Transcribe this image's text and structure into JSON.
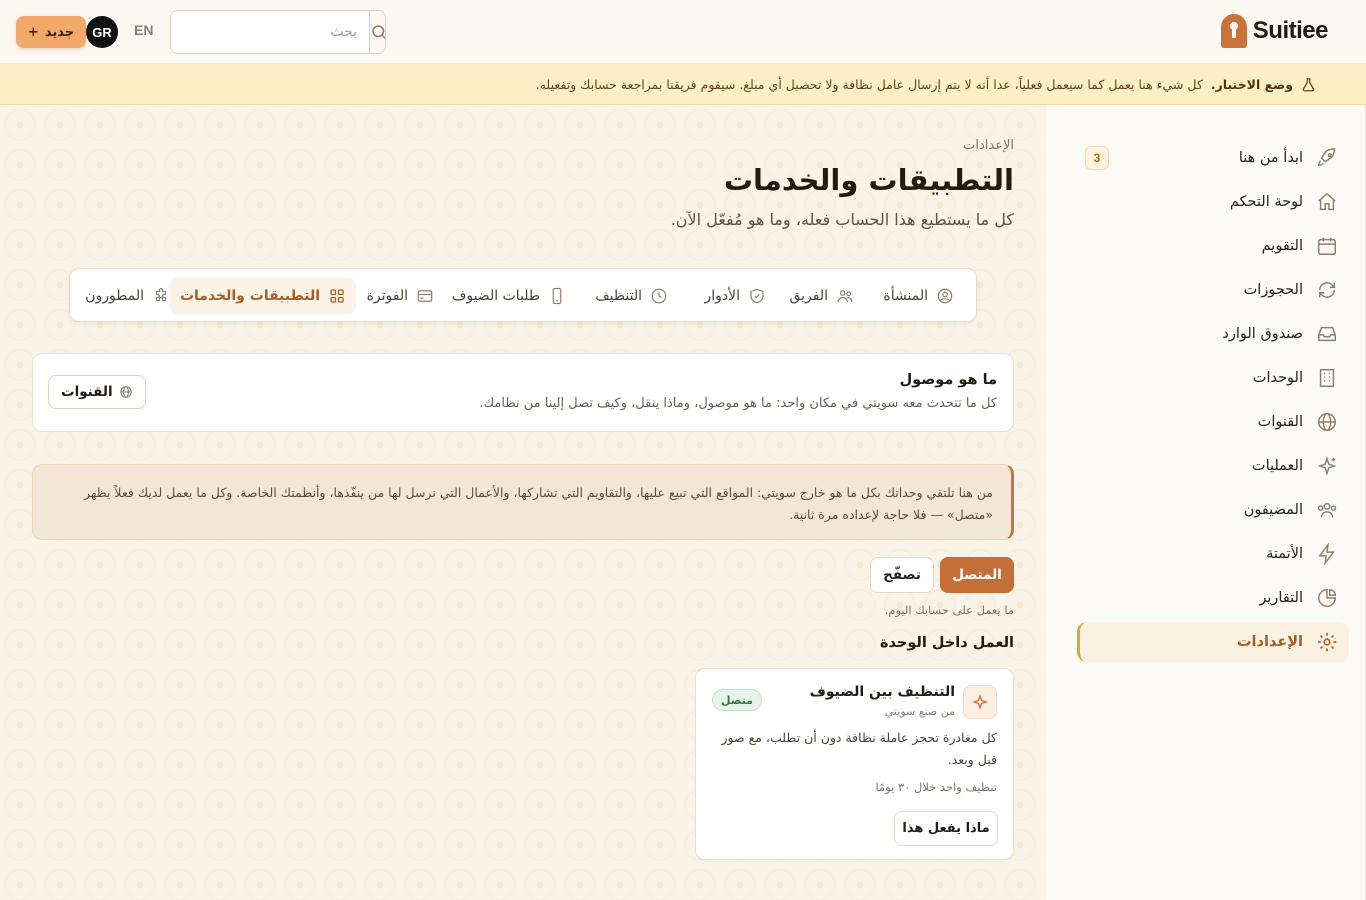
{
  "brand": {
    "name": "Suitiee"
  },
  "topbar": {
    "search_placeholder": "بحث",
    "lang": "EN",
    "avatar": "GR",
    "new_label": "جديد",
    "new_plus": "+"
  },
  "banner": {
    "label": "وضع الاختبار.",
    "text": "كل شيء هنا يعمل كما سيعمل فعلياً، عدا أنه لا يتم إرسال عامل نظافة ولا تحصيل أي مبلغ. سيقوم فريقنا بمراجعة حسابك وتفعيله."
  },
  "sidebar": {
    "items": [
      {
        "label": "ابدأ من هنا",
        "icon": "rocket-icon",
        "badge": "3"
      },
      {
        "label": "لوحة التحكم",
        "icon": "home-icon"
      },
      {
        "label": "التقويم",
        "icon": "calendar-icon"
      },
      {
        "label": "الحجوزات",
        "icon": "refresh-icon"
      },
      {
        "label": "صندوق الوارد",
        "icon": "inbox-icon"
      },
      {
        "label": "الوحدات",
        "icon": "building-icon"
      },
      {
        "label": "القنوات",
        "icon": "globe-icon"
      },
      {
        "label": "العمليات",
        "icon": "sparkles-icon"
      },
      {
        "label": "المضيفون",
        "icon": "users-icon"
      },
      {
        "label": "الأتمتة",
        "icon": "bolt-icon"
      },
      {
        "label": "التقارير",
        "icon": "pie-chart-icon"
      },
      {
        "label": "الإعدادات",
        "icon": "gear-icon",
        "active": true
      }
    ]
  },
  "page": {
    "breadcrumb": "الإعدادات",
    "title": "التطبيقات والخدمات",
    "subtitle": "كل ما يستطيع هذا الحساب فعله، وما هو مُفعّل الآن."
  },
  "tabs": [
    {
      "label": "المنشأة",
      "icon": "user-circle-icon"
    },
    {
      "label": "الفريق",
      "icon": "users-icon"
    },
    {
      "label": "الأدوار",
      "icon": "shield-icon"
    },
    {
      "label": "التنظيف",
      "icon": "clock-icon"
    },
    {
      "label": "طلبات الضيوف",
      "icon": "phone-icon"
    },
    {
      "label": "الفوترة",
      "icon": "credit-card-icon"
    },
    {
      "label": "التطبيقات والخدمات",
      "icon": "grid-icon",
      "active": true
    },
    {
      "label": "المطورون",
      "icon": "puzzle-icon"
    }
  ],
  "connected_card": {
    "title": "ما هو موصول",
    "text": "كل ما تتحدث معه سويتي في مكان واحد: ما هو موصول، وماذا ينقل، وكيف تصل إلينا من نظامك.",
    "button": "القنوات"
  },
  "note": {
    "text": "من هنا تلتقي وحداتك بكل ما هو خارج سويتي: المواقع التي تبيع عليها، والتقاويم التي تشاركها، والأعمال التي نرسل لها من ينفّذها، وأنظمتك الخاصة. وكل ما يعمل لديك فعلاً يظهر «متصل» — فلا حاجة لإعداده مرة ثانية."
  },
  "filters": {
    "connected": "المتصل",
    "browse": "تصفّح"
  },
  "hint": "ما يعمل على حسابك اليوم.",
  "section": {
    "title": "العمل داخل الوحدة"
  },
  "service": {
    "name": "التنظيف بين الضيوف",
    "by": "من صنع سويتي",
    "status": "متصل",
    "desc": "كل مغادرة تحجز عاملة نظافة دون أن تطلب، مع صور قبل وبعد.",
    "freq": "تنظيف واحد خلال ٣٠ يومًا",
    "button": "ماذا يفعل هذا"
  },
  "colors": {
    "accent": "#c46f38",
    "brand": "#c8733a",
    "banner": "#fcefc6",
    "success": "#2f7a46"
  }
}
